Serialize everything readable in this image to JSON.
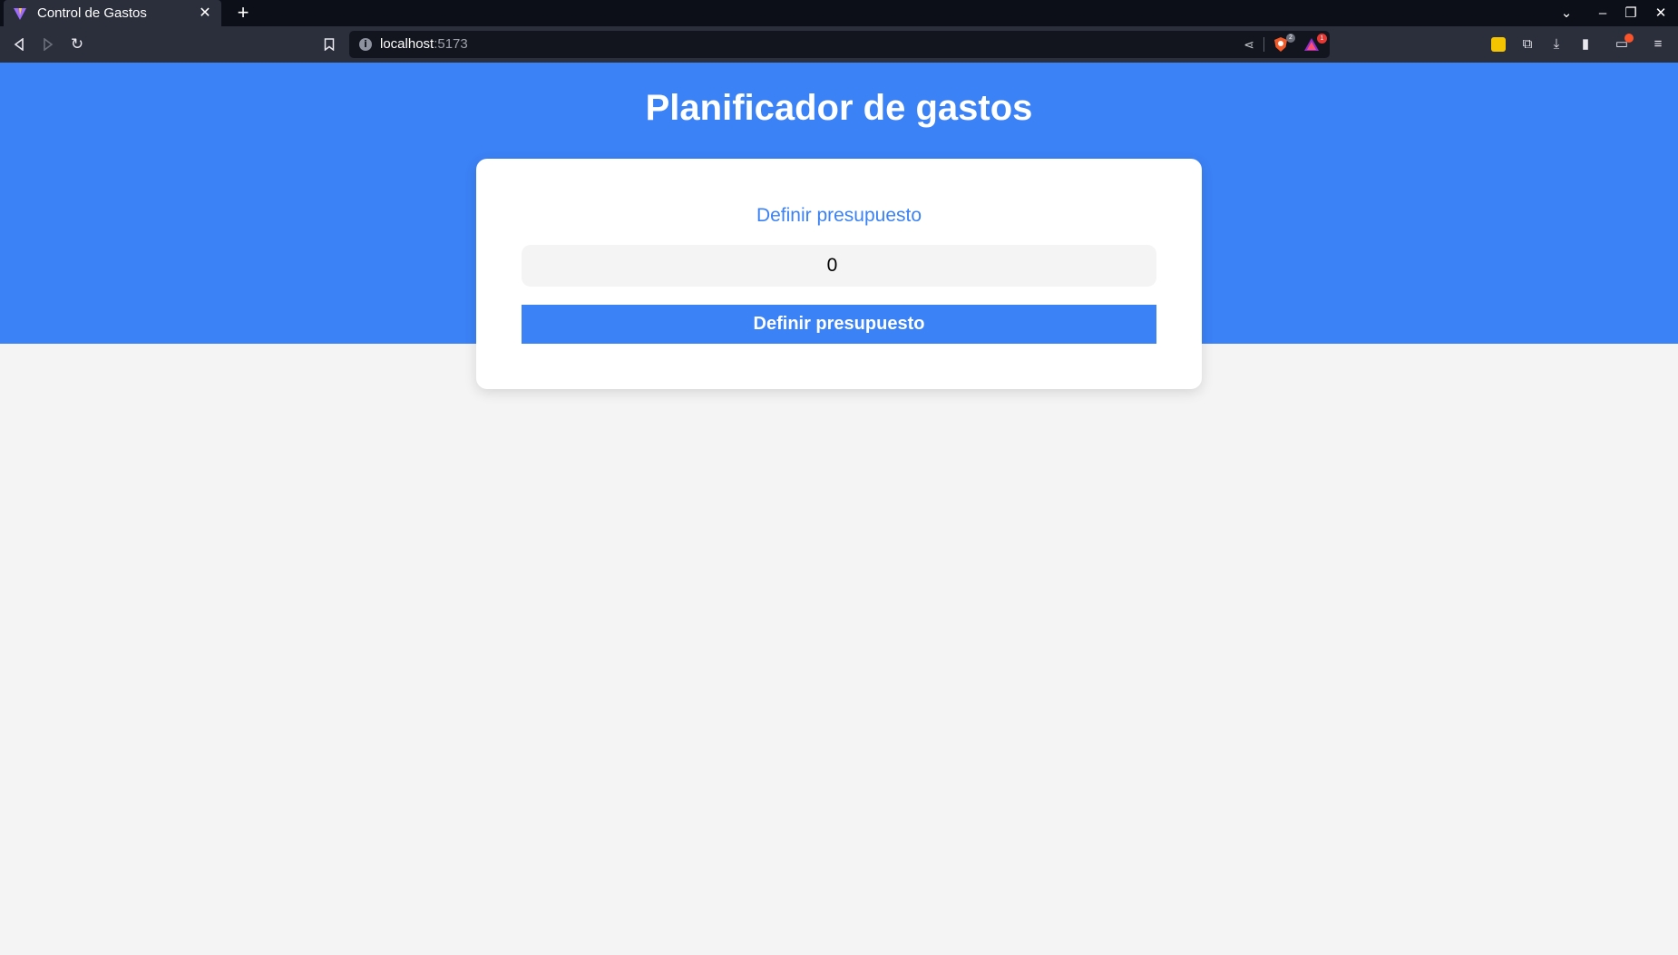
{
  "browser": {
    "tab": {
      "title": "Control de Gastos",
      "close": "✕"
    },
    "new_tab": "+",
    "window_controls": {
      "list": "⌄",
      "minimize": "–",
      "restore": "❐",
      "close": "✕"
    },
    "url": {
      "host": "localhost",
      "port": ":5173"
    },
    "badges": {
      "shields": "2",
      "rewards": "1"
    }
  },
  "page": {
    "title": "Planificador de gastos",
    "form": {
      "label": "Definir presupuesto",
      "input_value": "0",
      "submit_label": "Definir presupuesto"
    }
  },
  "colors": {
    "primary": "#3b82f6",
    "background": "#f4f4f4",
    "card": "#ffffff"
  }
}
